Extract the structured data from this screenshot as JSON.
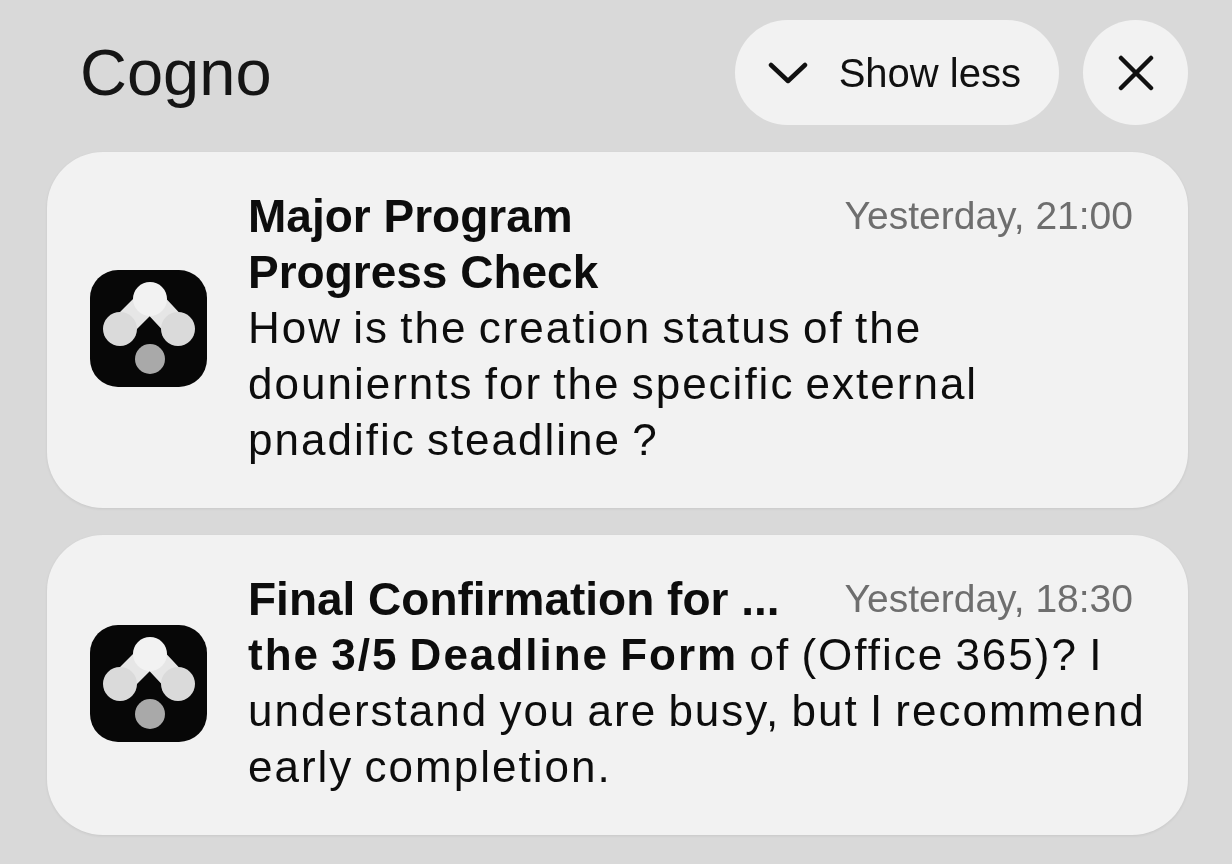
{
  "header": {
    "title": "Cogno",
    "show_less_button": {
      "label": "Show less"
    }
  },
  "notifications": [
    {
      "title": "Major Program Progress Check",
      "time": "Yesterday, 21:00",
      "body": "How is the creation status of the douniernts for the specific external pnadific steadline ?"
    },
    {
      "title": "Final Confirmation for ...",
      "time": "Yesterday, 18:30",
      "body": "**the 3/5 Deadline Form** of (Office 365)? I understand you are busy, but I recommend early completion."
    }
  ]
}
